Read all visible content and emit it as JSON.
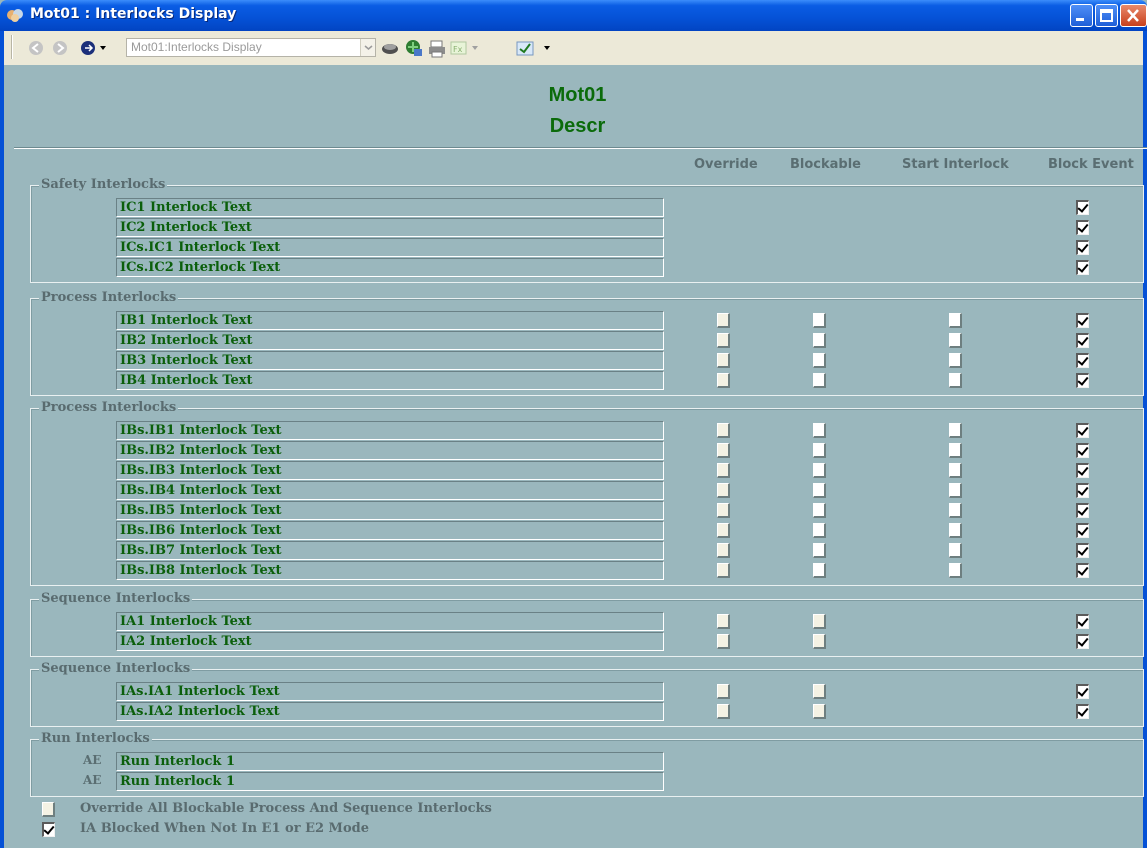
{
  "window": {
    "title": "Mot01 : Interlocks Display"
  },
  "toolbar": {
    "address": "Mot01:Interlocks Display"
  },
  "header": {
    "name": "Mot01",
    "description": "Descr"
  },
  "columns": [
    "Override",
    "Blockable",
    "Start Interlock",
    "Block Event"
  ],
  "groups": [
    {
      "label": "Safety Interlocks",
      "rows": [
        {
          "text": "IC1 Interlock Text",
          "override": null,
          "blockable": null,
          "start": null,
          "block_event": true
        },
        {
          "text": "IC2 Interlock Text",
          "override": null,
          "blockable": null,
          "start": null,
          "block_event": true
        },
        {
          "text": "ICs.IC1 Interlock Text",
          "override": null,
          "blockable": null,
          "start": null,
          "block_event": true
        },
        {
          "text": "ICs.IC2 Interlock Text",
          "override": null,
          "blockable": null,
          "start": null,
          "block_event": true
        }
      ]
    },
    {
      "label": "Process Interlocks",
      "rows": [
        {
          "text": "IB1 Interlock Text",
          "override": false,
          "blockable": false,
          "start": false,
          "block_event": true
        },
        {
          "text": "IB2 Interlock Text",
          "override": false,
          "blockable": false,
          "start": false,
          "block_event": true
        },
        {
          "text": "IB3 Interlock Text",
          "override": false,
          "blockable": false,
          "start": false,
          "block_event": true
        },
        {
          "text": "IB4 Interlock Text",
          "override": false,
          "blockable": false,
          "start": false,
          "block_event": true
        }
      ]
    },
    {
      "label": "Process Interlocks",
      "rows": [
        {
          "text": "IBs.IB1 Interlock Text",
          "override": false,
          "blockable": false,
          "start": false,
          "block_event": true
        },
        {
          "text": "IBs.IB2 Interlock Text",
          "override": false,
          "blockable": false,
          "start": false,
          "block_event": true
        },
        {
          "text": "IBs.IB3 Interlock Text",
          "override": false,
          "blockable": false,
          "start": false,
          "block_event": true
        },
        {
          "text": "IBs.IB4 Interlock Text",
          "override": false,
          "blockable": false,
          "start": false,
          "block_event": true
        },
        {
          "text": "IBs.IB5 Interlock Text",
          "override": false,
          "blockable": false,
          "start": false,
          "block_event": true
        },
        {
          "text": "IBs.IB6 Interlock Text",
          "override": false,
          "blockable": false,
          "start": false,
          "block_event": true
        },
        {
          "text": "IBs.IB7 Interlock Text",
          "override": false,
          "blockable": false,
          "start": false,
          "block_event": true
        },
        {
          "text": "IBs.IB8 Interlock Text",
          "override": false,
          "blockable": false,
          "start": false,
          "block_event": true
        }
      ]
    },
    {
      "label": "Sequence Interlocks",
      "rows": [
        {
          "text": "IA1 Interlock Text",
          "override": false,
          "blockable": false,
          "start": null,
          "block_event": true
        },
        {
          "text": "IA2 Interlock Text",
          "override": false,
          "blockable": false,
          "start": null,
          "block_event": true
        }
      ]
    },
    {
      "label": "Sequence Interlocks",
      "rows": [
        {
          "text": "IAs.IA1 Interlock Text",
          "override": false,
          "blockable": false,
          "start": null,
          "block_event": true
        },
        {
          "text": "IAs.IA2 Interlock Text",
          "override": false,
          "blockable": false,
          "start": null,
          "block_event": true
        }
      ]
    },
    {
      "label": "Run Interlocks",
      "rows": [
        {
          "prefix": "AE",
          "text": "Run Interlock 1",
          "override": null,
          "blockable": null,
          "start": null,
          "block_event": null
        },
        {
          "prefix": "AE",
          "text": "Run Interlock 1",
          "override": null,
          "blockable": null,
          "start": null,
          "block_event": null
        }
      ]
    }
  ],
  "footer": [
    {
      "label": "Override All Blockable Process And Sequence Interlocks",
      "checked": false
    },
    {
      "label": "IA Blocked When Not In E1 or E2 Mode",
      "checked": true
    }
  ],
  "colors": {
    "background": "#9ab7bd",
    "text_green": "#0b5f0b",
    "label_gray": "#596b6f",
    "titlebar": "#0551d6"
  }
}
